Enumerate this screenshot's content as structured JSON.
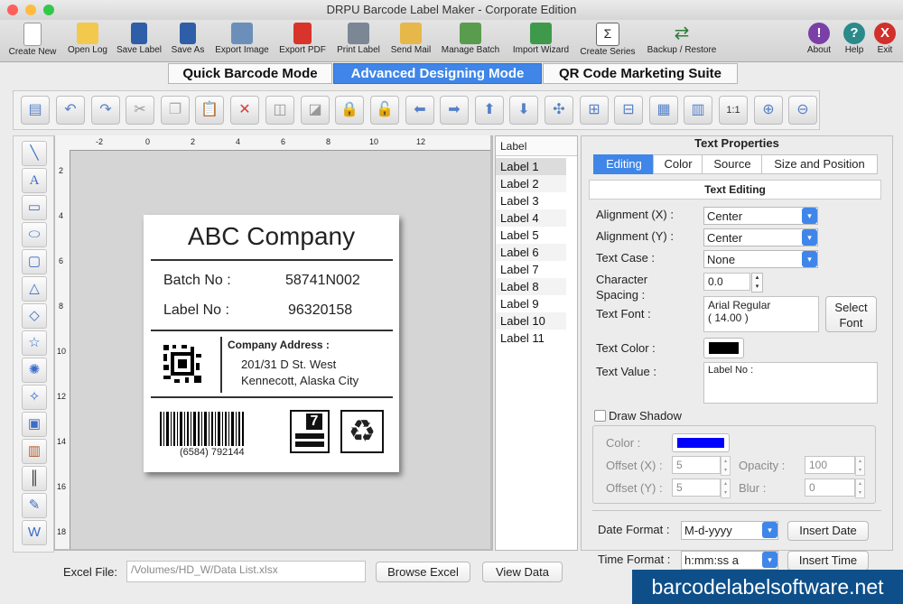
{
  "window": {
    "title": "DRPU Barcode Label Maker - Corporate Edition"
  },
  "toolbar": {
    "items": [
      {
        "label": "Create New"
      },
      {
        "label": "Open Log"
      },
      {
        "label": "Save Label"
      },
      {
        "label": "Save As"
      },
      {
        "label": "Export Image"
      },
      {
        "label": "Export PDF"
      },
      {
        "label": "Print Label"
      },
      {
        "label": "Send Mail"
      },
      {
        "label": "Manage Batch"
      },
      {
        "label": "Import Wizard"
      },
      {
        "label": "Create Series"
      },
      {
        "label": "Backup / Restore"
      }
    ],
    "right": [
      {
        "label": "About"
      },
      {
        "label": "Help"
      },
      {
        "label": "Exit"
      }
    ]
  },
  "modes": [
    "Quick Barcode Mode",
    "Advanced Designing Mode",
    "QR Code Marketing Suite"
  ],
  "label": {
    "company": "ABC Company",
    "batch_label": "Batch No :",
    "batch_value": "58741N002",
    "labelno_label": "Label No :",
    "labelno_value": "96320158",
    "address_title": "Company Address :",
    "address_line1": "201/31 D St. West",
    "address_line2": "Kennecott, Alaska City",
    "barcode_text": "(6584) 792144",
    "hazard_number": "7"
  },
  "ruler": {
    "h": [
      "-2",
      "0",
      "2",
      "4",
      "6",
      "8",
      "10",
      "12"
    ],
    "v": [
      "2",
      "4",
      "6",
      "8",
      "10",
      "12",
      "14",
      "16",
      "18"
    ]
  },
  "label_list": {
    "header": "Label",
    "items": [
      "Label 1",
      "Label 2",
      "Label 3",
      "Label 4",
      "Label 5",
      "Label 6",
      "Label 7",
      "Label 8",
      "Label 9",
      "Label 10",
      "Label 11"
    ]
  },
  "props": {
    "title": "Text Properties",
    "tabs": [
      "Editing",
      "Color",
      "Source",
      "Size and Position"
    ],
    "section": "Text Editing",
    "align_x_label": "Alignment (X) :",
    "align_x_value": "Center",
    "align_y_label": "Alignment (Y) :",
    "align_y_value": "Center",
    "case_label": "Text Case :",
    "case_value": "None",
    "spacing_label1": "Character",
    "spacing_label2": "Spacing :",
    "spacing_value": "0.0",
    "font_label": "Text Font :",
    "font_value1": "Arial Regular",
    "font_value2": "( 14.00 )",
    "select_font_1": "Select",
    "select_font_2": "Font",
    "color_label": "Text Color :",
    "text_color": "#000000",
    "value_label": "Text Value :",
    "text_value": "Label No :",
    "shadow_label": "Draw Shadow",
    "shadow_color_label": "Color :",
    "shadow_color": "#0000ff",
    "offx_label": "Offset (X) :",
    "offx_value": "5",
    "offy_label": "Offset (Y) :",
    "offy_value": "5",
    "opacity_label": "Opacity :",
    "opacity_value": "100",
    "blur_label": "Blur :",
    "blur_value": "0",
    "date_label": "Date Format :",
    "date_value": "M-d-yyyy",
    "insert_date": "Insert Date",
    "time_label": "Time Format :",
    "time_value": "h:mm:ss a",
    "insert_time": "Insert Time"
  },
  "bottom": {
    "excel_label": "Excel File:",
    "excel_path": "/Volumes/HD_W/Data List.xlsx",
    "browse": "Browse Excel",
    "view": "View Data"
  },
  "watermark": "barcodelabelsoftware.net"
}
